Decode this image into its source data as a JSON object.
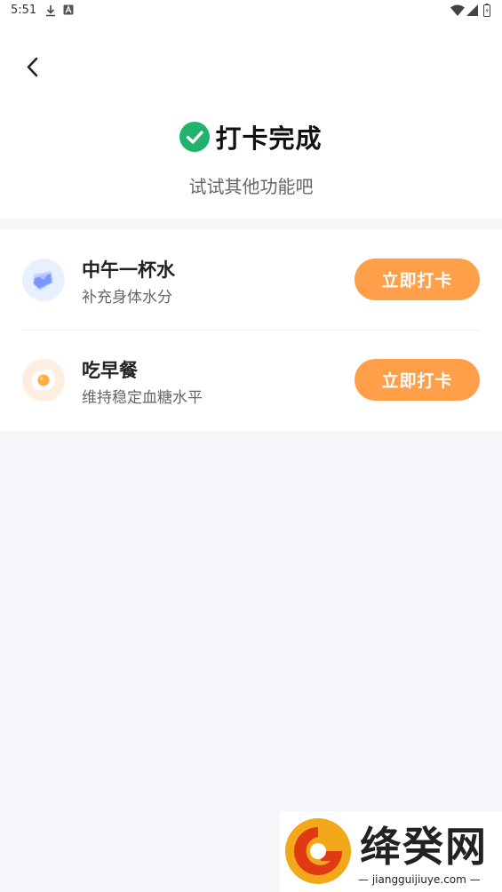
{
  "status_bar": {
    "time": "5:51"
  },
  "header": {
    "title": "打卡完成",
    "subtitle": "试试其他功能吧"
  },
  "tasks": [
    {
      "name": "中午一杯水",
      "desc": "补充身体水分",
      "button": "立即打卡",
      "icon": "water-cup-icon"
    },
    {
      "name": "吃早餐",
      "desc": "维持稳定血糖水平",
      "button": "立即打卡",
      "icon": "fried-egg-icon"
    }
  ],
  "colors": {
    "accent": "#ff9f4a",
    "success": "#21b36c",
    "background": "#f5f6fa"
  },
  "watermark": {
    "name": "绛癸网",
    "url": "— jiangguijiuye.com —"
  }
}
